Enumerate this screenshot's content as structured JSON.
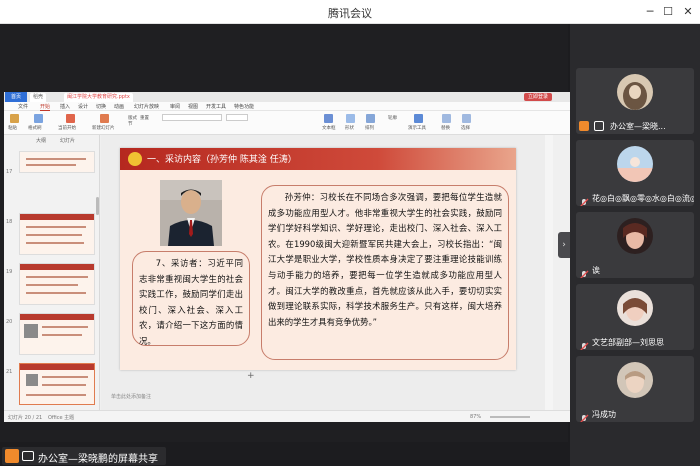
{
  "window": {
    "title": "腾讯会议",
    "minimize_glyph": "─",
    "maximize_glyph": "☐",
    "close_glyph": "✕"
  },
  "wps": {
    "home_tab": "首页",
    "tab_daoke": "稻壳",
    "doc_tab": "闽江学院大学教育研究.pptx",
    "login_label": "立即登录",
    "menu": [
      "文件",
      "开始",
      "插入",
      "设计",
      "切换",
      "动画",
      "幻灯片放映",
      "审阅",
      "视图",
      "开发工具",
      "特色功能"
    ],
    "active_menu_index": 1,
    "toolbar": [
      "粘贴",
      "格式刷",
      "当前开始",
      "新建幻灯片",
      "版式",
      "节",
      "重置",
      "文本框",
      "形状",
      "排列",
      "轮廓",
      "演示工具",
      "替换",
      "选择"
    ],
    "panel_tabs": [
      "大纲",
      "幻灯片"
    ],
    "thumb_numbers": [
      "17",
      "18",
      "19",
      "20",
      "21"
    ],
    "slide": {
      "title": "一、采访内容（孙芳仲 陈其淦 任涛）",
      "left_text": "7、采访者：习近平同志非常重视闽大学生的社会实践工作，鼓励同学们走出校门、深入社会、深入工农，请介绍一下这方面的情况。",
      "right_text": "孙芳仲：习校长在不同场合多次强调，要把每位学生造就成多功能应用型人才。他非常重视大学生的社会实践，鼓励同学们学好科学知识、学好理论，走出校门、深入社会、深入工农。在1990级闽大迎新暨军民共建大会上，习校长指出：“闽江大学是职业大学，学校性质本身决定了要注重理论技能训练与动手能力的培养，要把每一位学生造就成多功能应用型人才。闽江大学的教改重点，首先就应该从此入手，要切切实实做到理论联系实际，科学技术服务生产。只有这样，闽大培养出来的学生才具有竞争优势。”"
    },
    "notes_placeholder": "单击此处添加备注",
    "status": {
      "slide_count": "幻灯片 20 / 21",
      "theme": "Office 主题",
      "zoom": "87%"
    }
  },
  "participants": [
    {
      "name": "办公室—梁晓...",
      "speaking": true
    },
    {
      "name": "花◎白◎飘◎零◎水◎白◎流◎",
      "speaking": false
    },
    {
      "name": "诶",
      "speaking": false
    },
    {
      "name": "文艺部副部—刘思思",
      "speaking": false
    },
    {
      "name": "冯成功",
      "speaking": false
    }
  ],
  "sharer": {
    "label": "办公室—梁晓鹏的屏幕共享"
  },
  "colors": {
    "accent_red": "#b5281f",
    "wps_blue": "#2f6fd7",
    "share_orange": "#f08a2c"
  }
}
